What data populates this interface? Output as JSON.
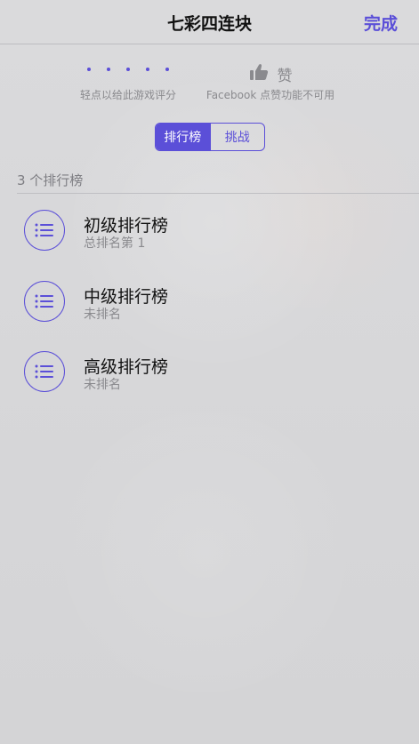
{
  "nav": {
    "title": "七彩四连块",
    "done_label": "完成"
  },
  "rating": {
    "caption": "轻点以给此游戏评分",
    "dots": 5
  },
  "like": {
    "label": "赞",
    "caption": "Facebook 点赞功能不可用"
  },
  "segments": [
    {
      "label": "排行榜",
      "selected": true
    },
    {
      "label": "挑战",
      "selected": false
    }
  ],
  "section": {
    "header": "3 个排行榜"
  },
  "leaderboards": [
    {
      "title": "初级排行榜",
      "subtitle": "总排名第 1"
    },
    {
      "title": "中级排行榜",
      "subtitle": "未排名"
    },
    {
      "title": "高级排行榜",
      "subtitle": "未排名"
    }
  ],
  "colors": {
    "accent": "#5b4fd8",
    "background": "#d6d6d8",
    "secondary_text": "#8a8a8e"
  },
  "icons": {
    "like": "thumbs-up-icon",
    "leaderboard": "list-icon"
  }
}
